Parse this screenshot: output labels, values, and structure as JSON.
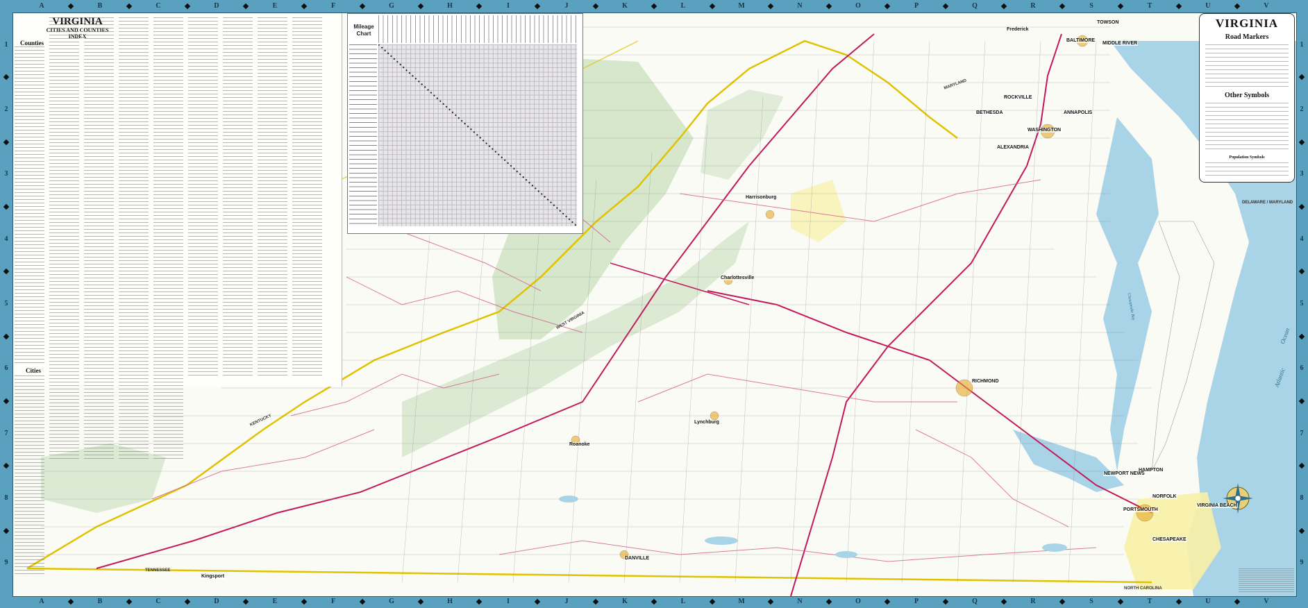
{
  "grid": {
    "letters": [
      "A",
      "B",
      "C",
      "D",
      "E",
      "F",
      "G",
      "H",
      "I",
      "J",
      "K",
      "L",
      "M",
      "N",
      "O",
      "P",
      "Q",
      "R",
      "S",
      "T",
      "U",
      "V"
    ],
    "numbers": [
      "1",
      "2",
      "3",
      "4",
      "5",
      "6",
      "7",
      "8",
      "9"
    ]
  },
  "index": {
    "title": "VIRGINIA",
    "subtitle_line1": "CITIES AND COUNTIES",
    "subtitle_line2": "INDEX",
    "counties_heading": "Counties",
    "cities_heading": "Cities"
  },
  "mileage_chart": {
    "title_line1": "Mileage",
    "title_line2": "Chart"
  },
  "legend": {
    "title": "VIRGINIA",
    "road_markers": "Road Markers",
    "other_symbols": "Other Symbols",
    "population_symbols": "Population Symbols"
  },
  "cities": {
    "washington": "WASHINGTON",
    "alexandria": "ALEXANDRIA",
    "bethesda": "BETHESDA",
    "rockville": "ROCKVILLE",
    "annapolis": "ANNAPOLIS",
    "baltimore": "BALTIMORE",
    "middle_river": "MIDDLE RIVER",
    "towson": "TOWSON",
    "richmond": "RICHMOND",
    "hampton": "HAMPTON",
    "newport_news": "NEWPORT NEWS",
    "norfolk": "NORFOLK",
    "portsmouth": "PORTSMOUTH",
    "chesapeake": "CHESAPEAKE",
    "virginia_beach": "VIRGINIA BEACH",
    "danville": "DANVILLE",
    "roanoke": "Roanoke",
    "kingsport": "Kingsport",
    "charlottesville": "Charlottesville",
    "lynchburg": "Lynchburg",
    "harrisonburg": "Harrisonburg",
    "frederick": "Frederick"
  },
  "regions": {
    "north_carolina": "NORTH CAROLINA",
    "tennessee": "TENNESSEE",
    "kentucky": "KENTUCKY",
    "west_virginia": "WEST VIRGINIA",
    "maryland": "MARYLAND",
    "delaware_maryland": "DELAWARE / MARYLAND",
    "atlantic": "Atlantic",
    "ocean": "Ocean",
    "chesapeake_bay": "Chesapeake Bay"
  },
  "colors": {
    "frame": "#5aa0bf",
    "land": "#fbfbf6",
    "water": "#a9d3e6",
    "forest": "#cfe3c4",
    "interstate": "#c2185b",
    "us_route": "#d25a8a",
    "state_line": "#e0c200"
  }
}
